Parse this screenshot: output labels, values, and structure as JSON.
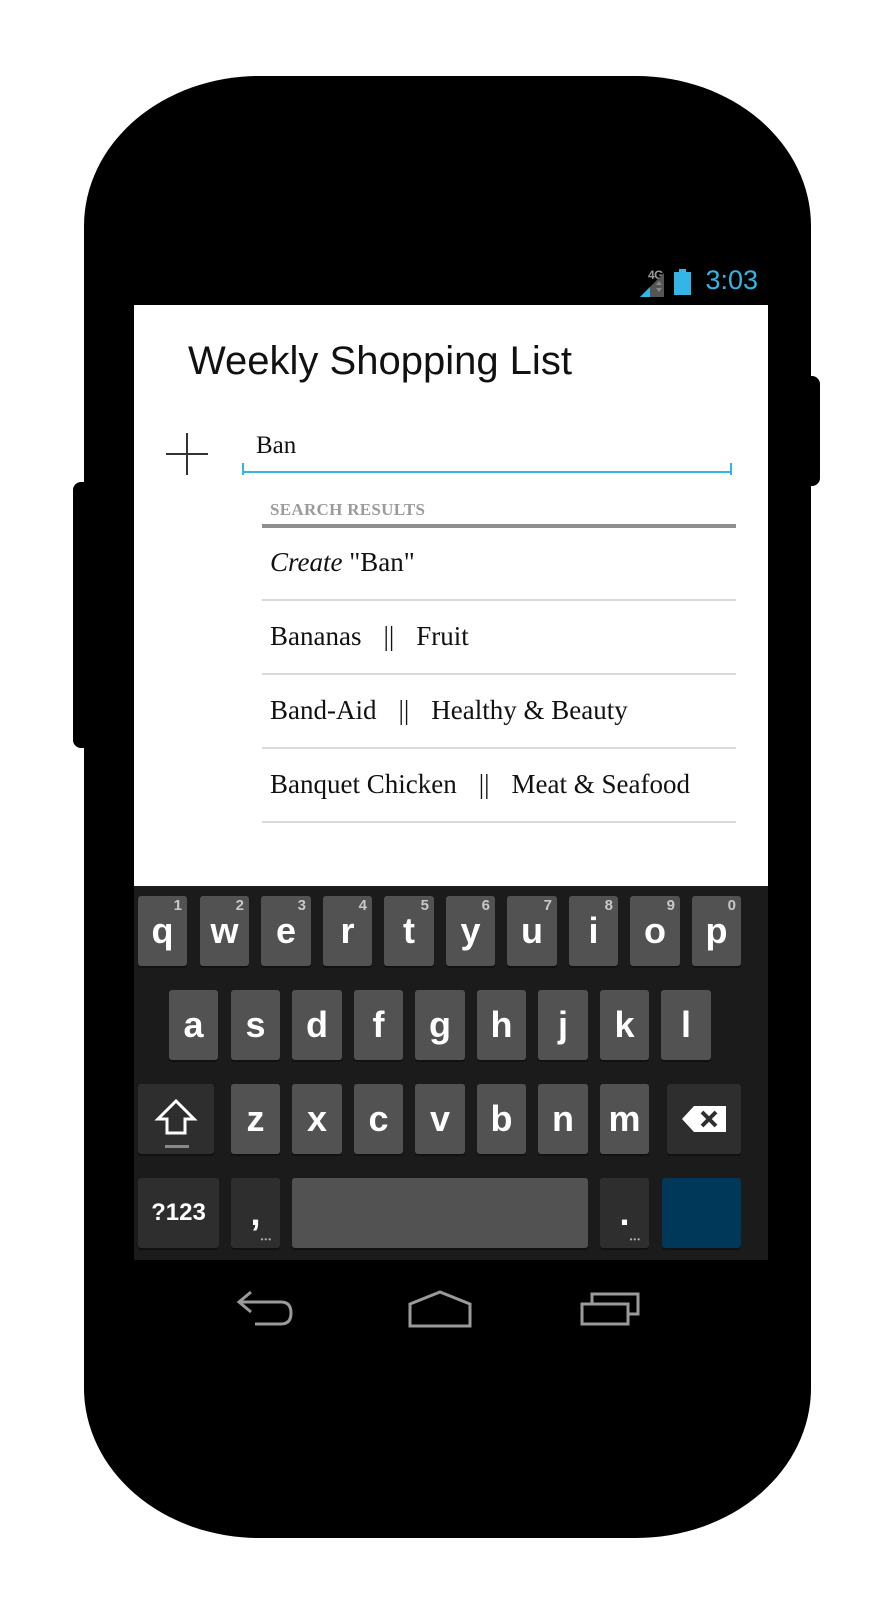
{
  "status_bar": {
    "network": "4G",
    "time": "3:03"
  },
  "app": {
    "title": "Weekly Shopping List",
    "search_input_value": "Ban",
    "results_header": "SEARCH RESULTS",
    "create_prefix": "Create",
    "create_value": "\"Ban\"",
    "separator": "||",
    "results": [
      {
        "name": "Bananas",
        "category": "Fruit"
      },
      {
        "name": "Band-Aid",
        "category": "Healthy & Beauty"
      },
      {
        "name": "Banquet Chicken",
        "category": "Meat & Seafood"
      }
    ]
  },
  "keyboard": {
    "row1": [
      {
        "label": "q",
        "hint": "1"
      },
      {
        "label": "w",
        "hint": "2"
      },
      {
        "label": "e",
        "hint": "3"
      },
      {
        "label": "r",
        "hint": "4"
      },
      {
        "label": "t",
        "hint": "5"
      },
      {
        "label": "y",
        "hint": "6"
      },
      {
        "label": "u",
        "hint": "7"
      },
      {
        "label": "i",
        "hint": "8"
      },
      {
        "label": "o",
        "hint": "9"
      },
      {
        "label": "p",
        "hint": "0"
      }
    ],
    "row2": [
      "a",
      "s",
      "d",
      "f",
      "g",
      "h",
      "j",
      "k",
      "l"
    ],
    "row3": [
      "z",
      "x",
      "c",
      "v",
      "b",
      "n",
      "m"
    ],
    "symbols_label": "?123",
    "comma_label": ",",
    "period_label": ".",
    "accent_color": "#00385a"
  },
  "colors": {
    "holo_blue": "#33b5e5"
  }
}
